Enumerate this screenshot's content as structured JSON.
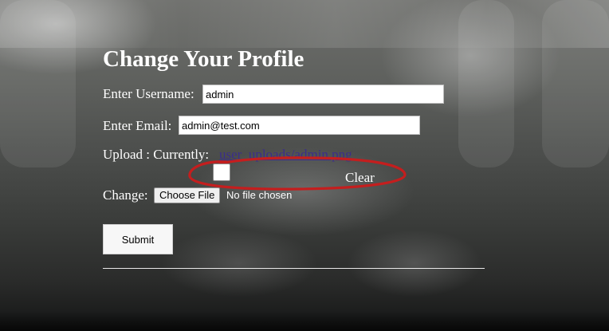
{
  "form": {
    "title": "Change Your Profile",
    "username": {
      "label": "Enter Username:",
      "value": "admin"
    },
    "email": {
      "label": "Enter Email:",
      "value": "admin@test.com"
    },
    "upload": {
      "label": "Upload : Currently:",
      "current_file_link": "user_uploads/admin.png",
      "clear_label": "Clear",
      "change_label": "Change:",
      "choose_button": "Choose File",
      "file_status": "No file chosen"
    },
    "submit_label": "Submit"
  },
  "colors": {
    "annotation": "#c41e1e",
    "link": "#3b2e8a"
  }
}
